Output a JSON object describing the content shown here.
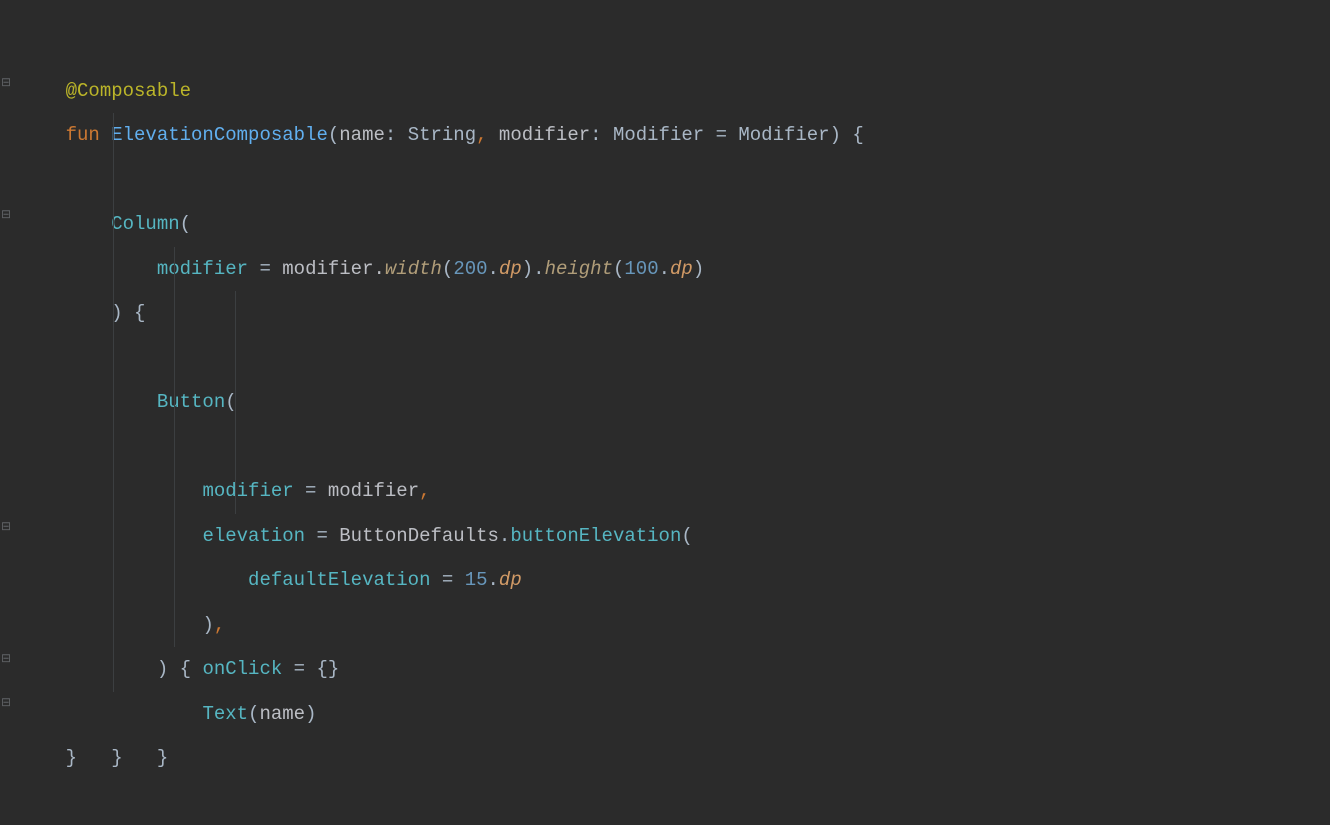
{
  "code": {
    "l1": {
      "ann": "@Composable"
    },
    "l2": {
      "kw": "fun ",
      "name": "ElevationComposable",
      "lp": "(",
      "p1": "name",
      "c1": ": ",
      "t1": "String",
      "comma1": ", ",
      "p2": "modifier",
      "c2": ": ",
      "t2": "Modifier = Modifier",
      "rp": ")",
      "sp": " ",
      "ob": "{"
    },
    "l3": {
      "indent": "    ",
      "call": "Column",
      "lp": "("
    },
    "l4": {
      "indent": "        ",
      "arg": "modifier",
      "eq": " = ",
      "expr": "modifier.",
      "m1": "width",
      "lp1": "(",
      "n1": "200",
      "dot1": ".",
      "dp1": "dp",
      "rp1": ")",
      "dot2": ".",
      "m2": "height",
      "lp2": "(",
      "n2": "100",
      "dot3": ".",
      "dp2": "dp",
      "rp2": ")"
    },
    "l5": {
      "indent": "    ",
      "rp": ")",
      "sp": " ",
      "ob": "{"
    },
    "l6": {
      "indent": "        ",
      "call": "Button",
      "lp": "("
    },
    "l7": {
      "indent": "            ",
      "arg": "modifier",
      "eq": " = ",
      "expr": "modifier",
      "comma": ","
    },
    "l8": {
      "indent": "            ",
      "arg": "elevation",
      "eq": " = ",
      "cls": "ButtonDefaults",
      "dot": ".",
      "method": "buttonElevation",
      "lp": "("
    },
    "l9": {
      "indent": "                ",
      "arg": "defaultElevation",
      "eq": " = ",
      "num": "15",
      "dot": ".",
      "dp": "dp"
    },
    "l10": {
      "indent": "            ",
      "rp": ")",
      "comma": ","
    },
    "l11": {
      "indent": "            ",
      "arg": "onClick",
      "eq": " = ",
      "ob": "{",
      "cb": "}"
    },
    "l12": {
      "indent": "        ",
      "rp": ")",
      "sp": " ",
      "ob": "{"
    },
    "l13": {
      "indent": "            ",
      "call": "Text",
      "lp": "(",
      "var": "name",
      "rp": ")"
    },
    "l14": {
      "indent": "        ",
      "cb": "}"
    },
    "l15": {
      "indent": "    ",
      "cb": "}"
    },
    "l16": {
      "cb": "}"
    }
  }
}
